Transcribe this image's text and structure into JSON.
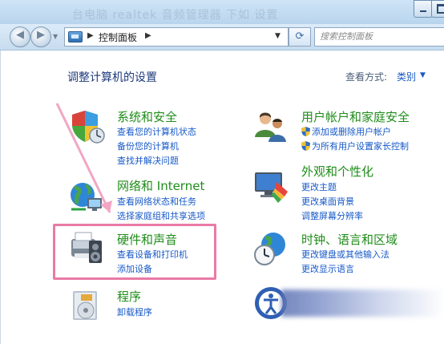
{
  "window": {
    "ghost_title": "台电脑 realtek 音频管理器 下如 设置"
  },
  "address_bar": {
    "breadcrumb_root": "控制面板",
    "search_placeholder": "搜索控制面板"
  },
  "content": {
    "title": "调整计算机的设置",
    "view_by_label": "查看方式:",
    "view_by_value": "类别"
  },
  "categories": [
    {
      "title": "系统和安全",
      "icon": "system-security-icon",
      "links": [
        "查看您的计算机状态",
        "备份您的计算机",
        "查找并解决问题"
      ]
    },
    {
      "title": "网络和 Internet",
      "icon": "network-internet-icon",
      "links": [
        "查看网络状态和任务",
        "选择家庭组和共享选项"
      ]
    },
    {
      "title": "硬件和声音",
      "icon": "hardware-sound-icon",
      "links": [
        "查看设备和打印机",
        "添加设备"
      ]
    },
    {
      "title": "程序",
      "icon": "programs-icon",
      "links": [
        "卸载程序"
      ]
    },
    {
      "title": "用户帐户和家庭安全",
      "icon": "user-accounts-icon",
      "links": [
        "添加或删除用户帐户",
        "为所有用户设置家长控制"
      ]
    },
    {
      "title": "外观和个性化",
      "icon": "appearance-icon",
      "links": [
        "更改主题",
        "更改桌面背景",
        "调整屏幕分辨率"
      ]
    },
    {
      "title": "时钟、语言和区域",
      "icon": "clock-language-icon",
      "links": [
        "更改键盘或其他输入法",
        "更改显示语言"
      ]
    }
  ],
  "colors": {
    "category_title": "#1f8d1a",
    "link": "#1659c8",
    "highlight_box": "#e97aa6",
    "annotation_arrow": "#f2a6c4"
  }
}
